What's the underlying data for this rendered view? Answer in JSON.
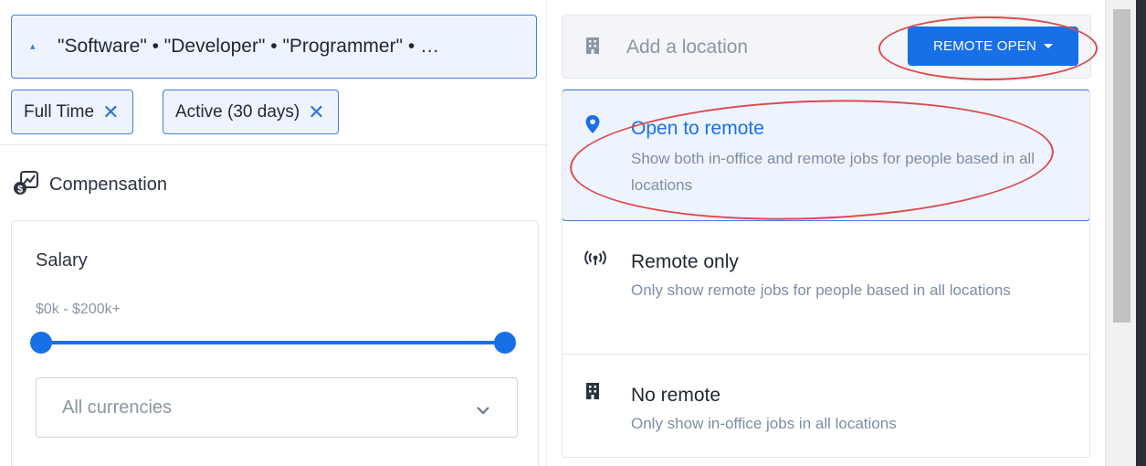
{
  "search": {
    "keywords_text": "\"Software\" • \"Developer\" • \"Programmer\" • …"
  },
  "filters": {
    "chips": [
      {
        "label": "Full Time"
      },
      {
        "label": "Active (30 days)"
      }
    ],
    "remove_glyph": "✕"
  },
  "compensation": {
    "title": "Compensation",
    "salary": {
      "title": "Salary",
      "range_text": "$0k - $200k+",
      "slider_min_fraction": 0.0,
      "slider_max_fraction": 1.0
    },
    "currency": {
      "selected": "All currencies"
    }
  },
  "location": {
    "placeholder": "Add a location",
    "remote_button_label": "REMOTE OPEN",
    "options": [
      {
        "title": "Open to remote",
        "description": "Show both in-office and remote jobs for people based in all locations",
        "icon": "map-pin-icon",
        "selected": true
      },
      {
        "title": "Remote only",
        "description": "Only show remote jobs for people based in all locations",
        "icon": "broadcast-icon",
        "selected": false
      },
      {
        "title": "No remote",
        "description": "Only show in-office jobs in all locations",
        "icon": "building-icon",
        "selected": false
      }
    ]
  },
  "colors": {
    "accent": "#1870e8",
    "selected_bg": "#eef4fd",
    "annotation": "#e0474c",
    "muted_text": "#7c8ea6"
  },
  "icons": {
    "keyword": "person-icon",
    "compensation": "salary-chart-icon",
    "currency_dropdown": "chevron-down-icon",
    "location_input": "building-icon",
    "remote_dropdown": "caret-down-icon"
  }
}
